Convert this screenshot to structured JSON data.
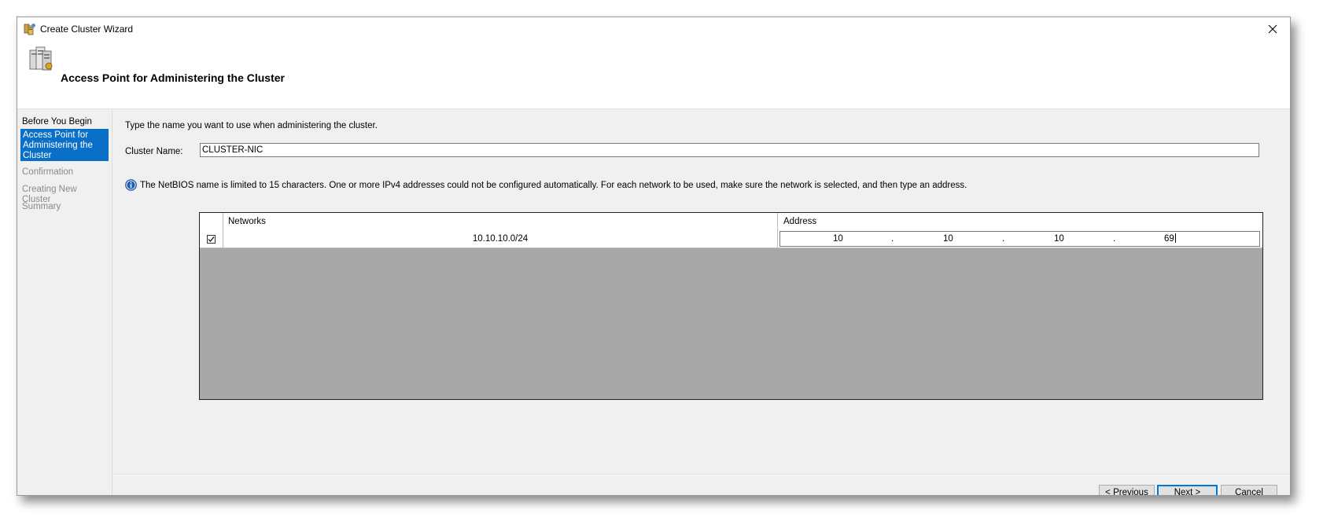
{
  "window": {
    "title": "Create Cluster Wizard",
    "icon": "cluster-wizard-icon"
  },
  "header": {
    "title": "Access Point for Administering the Cluster",
    "icon": "cluster-servers-icon"
  },
  "nav": {
    "items": [
      {
        "label": "Before You Begin",
        "state": "done"
      },
      {
        "label": "Access Point for Administering the Cluster",
        "state": "active"
      },
      {
        "label": "Confirmation",
        "state": "pending"
      },
      {
        "label": "Creating New Cluster",
        "state": "pending"
      },
      {
        "label": "Summary",
        "state": "pending"
      }
    ]
  },
  "content": {
    "instruction": "Type the name you want to use when administering the cluster.",
    "cluster_name_label": "Cluster Name:",
    "cluster_name_value": "CLUSTER-NIC",
    "info_message": "The NetBIOS name is limited to 15 characters.  One or more IPv4 addresses could not be configured automatically.  For each network to be used, make sure the network is selected, and then type an address."
  },
  "networks_grid": {
    "columns": {
      "networks": "Networks",
      "address": "Address"
    },
    "rows": [
      {
        "checked": true,
        "network": "10.10.10.0/24",
        "address": [
          "10",
          "10",
          "10",
          "69"
        ]
      }
    ]
  },
  "footer": {
    "previous_label": "< Previous",
    "next_label": "Next >",
    "cancel_label": "Cancel"
  },
  "colors": {
    "active_nav": "#0a6fc7",
    "primary_button_border": "#0078d7",
    "grid_empty_area": "#a8a8a8"
  }
}
